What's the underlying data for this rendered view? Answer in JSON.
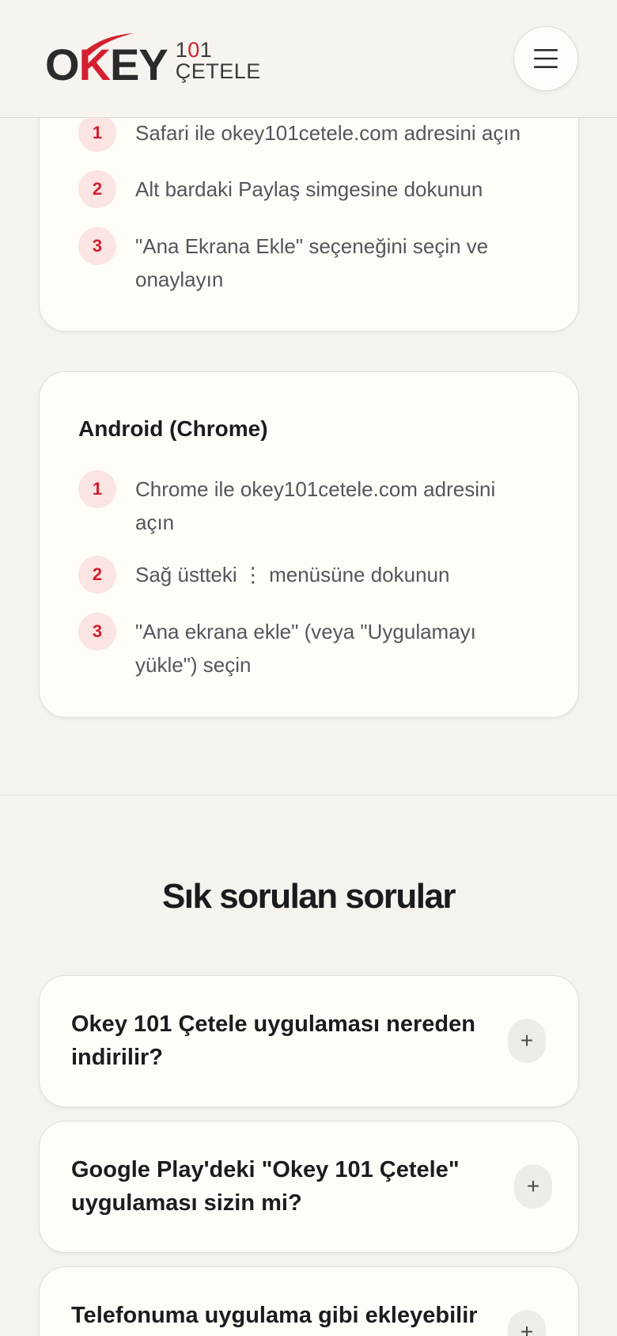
{
  "header": {
    "logo_main_prefix": "O",
    "logo_main_k": "K",
    "logo_main_suffix": "EY",
    "logo_sub_prefix": "1",
    "logo_sub_red": "0",
    "logo_sub_suffix": "1 ÇETELE"
  },
  "ios_steps": [
    {
      "num": "1",
      "text": "Safari ile okey101cetele.com adresini açın"
    },
    {
      "num": "2",
      "text": "Alt bardaki Paylaş simgesine dokunun"
    },
    {
      "num": "3",
      "text": "\"Ana Ekrana Ekle\" seçeneğini seçin ve onaylayın"
    }
  ],
  "android": {
    "title": "Android (Chrome)",
    "steps": [
      {
        "num": "1",
        "text": "Chrome ile okey101cetele.com adresini açın"
      },
      {
        "num": "2",
        "text": "Sağ üstteki ⋮ menüsüne dokunun"
      },
      {
        "num": "3",
        "text": "\"Ana ekrana ekle\" (veya \"Uygulamayı yükle\") seçin"
      }
    ]
  },
  "faq": {
    "title": "Sık sorulan sorular",
    "items": [
      {
        "question": "Okey 101 Çetele uygulaması nereden indirilir?",
        "toggle": "+"
      },
      {
        "question": "Google Play'deki \"Okey 101 Çetele\" uygulaması sizin mi?",
        "toggle": "+"
      },
      {
        "question": "Telefonuma uygulama gibi ekleyebilir miyim?",
        "toggle": "+"
      }
    ]
  },
  "colors": {
    "accent": "#d42030",
    "background": "#f6f3ee",
    "card": "#fffdf7"
  }
}
